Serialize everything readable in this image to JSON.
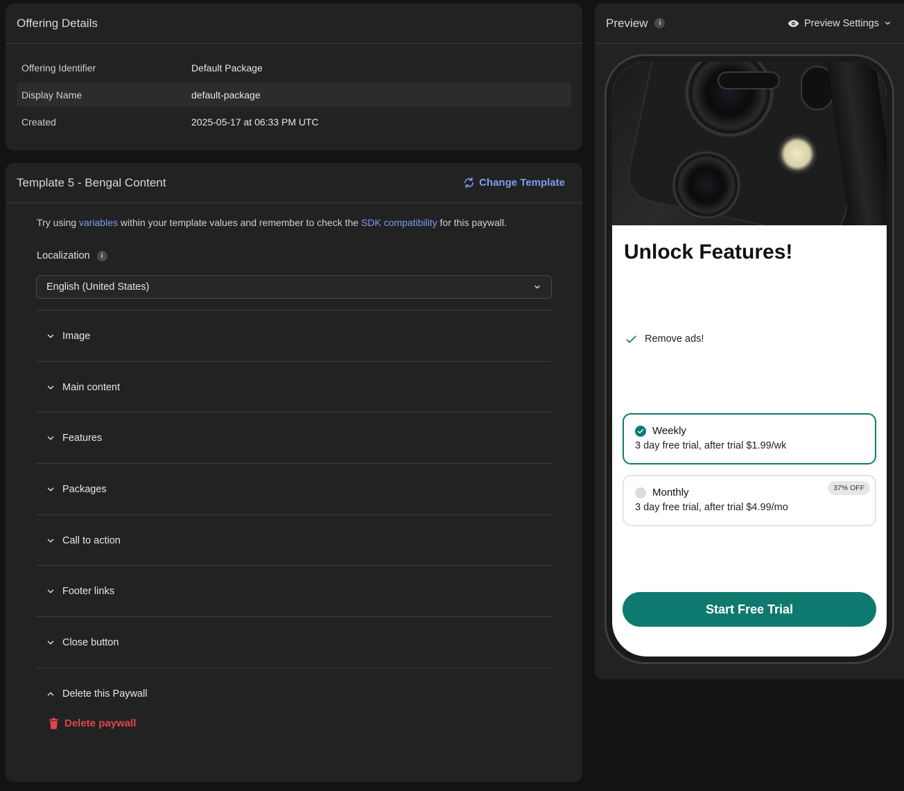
{
  "offering": {
    "title": "Offering Details",
    "rows": [
      {
        "label": "Offering Identifier",
        "value": "Default Package"
      },
      {
        "label": "Display Name",
        "value": "default-package"
      },
      {
        "label": "Created",
        "value": "2025-05-17 at 06:33 PM UTC"
      }
    ]
  },
  "template": {
    "title": "Template 5 - Bengal Content",
    "change_label": "Change Template",
    "hint": {
      "part1": "Try using ",
      "link1": "variables",
      "part2": " within your template values and remember to check the ",
      "link2": "SDK compatibility",
      "part3": " for this paywall."
    },
    "localization_label": "Localization",
    "localization_value": "English (United States)",
    "sections": [
      "Image",
      "Main content",
      "Features",
      "Packages",
      "Call to action",
      "Footer links",
      "Close button",
      "Delete this Paywall"
    ],
    "delete_label": "Delete paywall"
  },
  "preview": {
    "title": "Preview",
    "settings_label": "Preview Settings",
    "paywall": {
      "title": "Unlock Features!",
      "feature": "Remove ads!",
      "packages": [
        {
          "name": "Weekly",
          "desc": "3 day free trial, after trial $1.99/wk",
          "selected": true
        },
        {
          "name": "Monthly",
          "desc": "3 day free trial, after trial $4.99/mo",
          "badge": "37% OFF",
          "selected": false
        }
      ],
      "cta": "Start Free Trial"
    }
  },
  "colors": {
    "accent_link": "#7d9cf3",
    "paywall_primary": "#0e7a6f",
    "danger": "#e0454d",
    "panel": "#222222",
    "background": "#131313"
  }
}
